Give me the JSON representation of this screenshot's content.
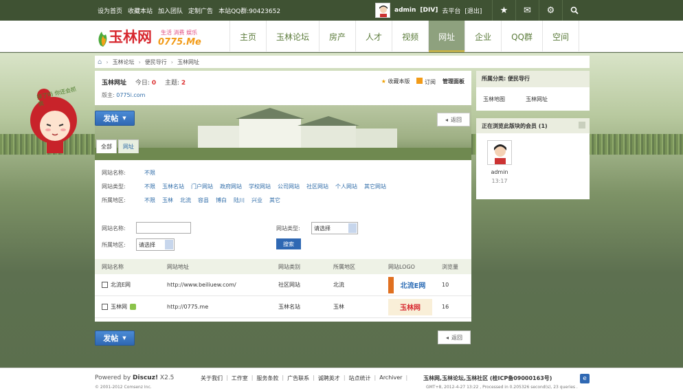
{
  "topbar": {
    "links": [
      "设为首页",
      "收藏本站",
      "加入团队",
      "定制广告",
      "本站QQ群:90423652"
    ],
    "user": "admin",
    "role": "[DIV]",
    "platform": "去平台",
    "logout": "[退出]"
  },
  "header": {
    "logo_main": "玉林网",
    "logo_sub": "生活 消费 娱乐",
    "logo_domain": "0775.Me",
    "nav": [
      "主页",
      "玉林论坛",
      "房产",
      "人才",
      "视频",
      "网址",
      "企业",
      "QQ群",
      "空间"
    ],
    "active_nav": "网址"
  },
  "breadcrumb": [
    "玉林论坛",
    "便民导行",
    "玉林网址"
  ],
  "forum": {
    "title": "玉林网址",
    "today_label": "今日:",
    "today": "0",
    "topics_label": "主题:",
    "topics": "2",
    "moderator_label": "版主:",
    "moderator": "0775i.com",
    "actions": [
      "收藏本版",
      "订阅",
      "管理面板"
    ]
  },
  "banner_text": "摔了吗 你还会抓我",
  "post_button": "发帖",
  "back_button": "返回",
  "tabs": [
    "全部",
    "网址"
  ],
  "filters": [
    {
      "label": "网站名称:",
      "options": [
        "不限"
      ]
    },
    {
      "label": "网站类型:",
      "options": [
        "不限",
        "玉林名站",
        "门户网站",
        "政府网站",
        "学校网站",
        "公司网站",
        "社区网站",
        "个人网站",
        "其它网站"
      ]
    },
    {
      "label": "所属地区:",
      "options": [
        "不限",
        "玉林",
        "北流",
        "容县",
        "博白",
        "陆川",
        "兴业",
        "其它"
      ]
    }
  ],
  "search": {
    "name_label": "网站名称:",
    "type_label": "网站类型:",
    "region_label": "所属地区:",
    "select_placeholder": "请选择",
    "search_button": "搜索"
  },
  "table": {
    "headers": [
      "网站名称",
      "网站地址",
      "网站类别",
      "所属地区",
      "网站LOGO",
      "浏览量"
    ],
    "rows": [
      {
        "name": "北流E网",
        "url": "http://www.beiliuew.com/",
        "category": "社区网站",
        "region": "北流",
        "logo": "北流E网",
        "views": "10"
      },
      {
        "name": "玉林网",
        "url": "http://0775.me",
        "category": "玉林名站",
        "region": "玉林",
        "logo": "玉林网",
        "views": "16"
      }
    ]
  },
  "sidebar": {
    "category_title": "所属分类: 便民导行",
    "category_links": [
      "玉林地图",
      "玉林网址"
    ],
    "online_title": "正在浏览此版块的会员 (1)",
    "member_name": "admin",
    "member_time": "13:17"
  },
  "footer": {
    "powered": "Powered by",
    "discuz": "Discuz!",
    "version": "X2.5",
    "copyright": "© 2001-2012 Comsenz Inc.",
    "links": [
      "关于我们",
      "工作室",
      "服务条款",
      "广告联系",
      "诚聘英才",
      "站点统计",
      "Archiver"
    ],
    "site": "玉林网,玉林论坛,玉林社区 (桂ICP备09000163号)",
    "gmt": "GMT+8, 2012-4-27 13:22 , Processed in 0.205326 second(s), 23 queries ."
  }
}
